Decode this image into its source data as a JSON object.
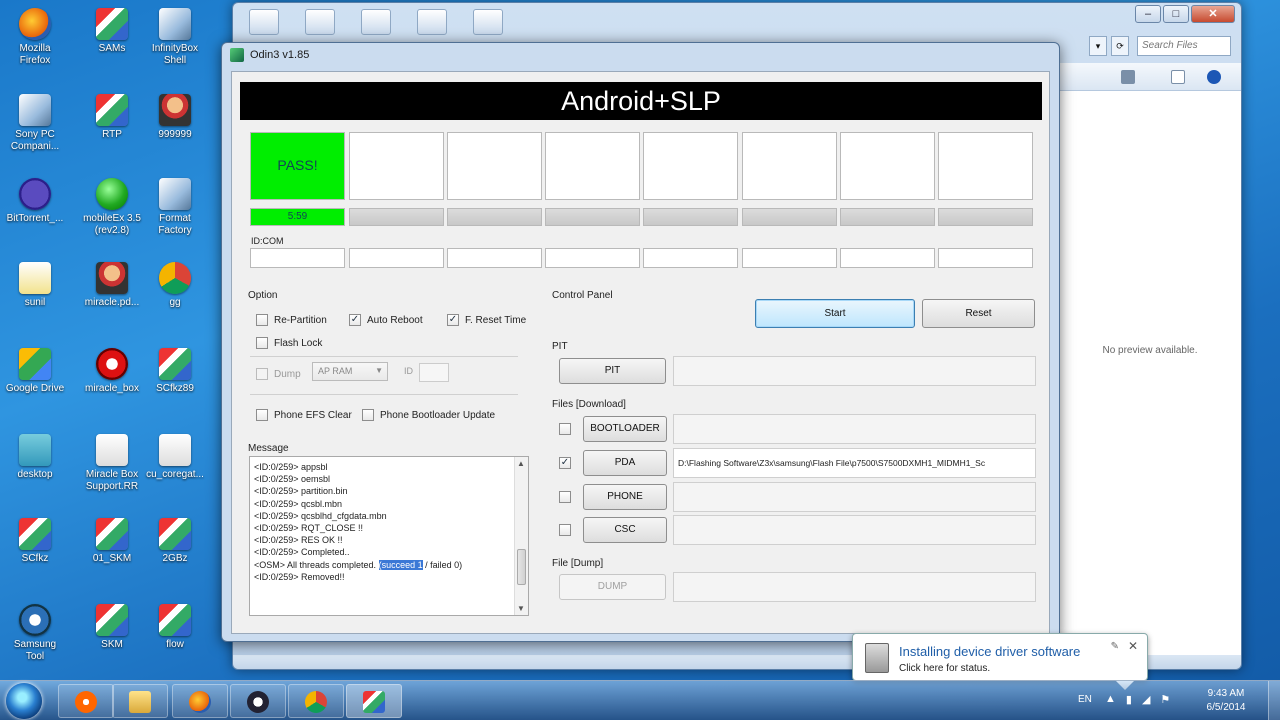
{
  "desktop": {
    "icons": [
      {
        "label": "Mozilla\nFirefox",
        "kind": "firefox",
        "name": "desktop-icon-firefox"
      },
      {
        "label": "SAMs",
        "kind": "app",
        "name": "desktop-icon-sams"
      },
      {
        "label": "InfinityBox\nShell",
        "kind": "win",
        "name": "desktop-icon-infinitybox"
      },
      {
        "label": "Sony PC\nCompani...",
        "kind": "win",
        "name": "desktop-icon-sony-pc"
      },
      {
        "label": "RTP",
        "kind": "app",
        "name": "desktop-icon-rtp"
      },
      {
        "label": "999999",
        "kind": "person",
        "name": "desktop-icon-999999"
      },
      {
        "label": "BitTorrent_...",
        "kind": "torrent",
        "name": "desktop-icon-bittorrent"
      },
      {
        "label": "mobileEx 3.5\n(rev2.8)",
        "kind": "globe",
        "name": "desktop-icon-mobileex"
      },
      {
        "label": "Format\nFactory",
        "kind": "win",
        "name": "desktop-icon-format-factory"
      },
      {
        "label": "sunil",
        "kind": "doc",
        "name": "desktop-icon-sunil"
      },
      {
        "label": "miracle.pd...",
        "kind": "person",
        "name": "desktop-icon-miracle-pd"
      },
      {
        "label": "gg",
        "kind": "chrome",
        "name": "desktop-icon-gg"
      },
      {
        "label": "Google Drive",
        "kind": "drive",
        "name": "desktop-icon-google-drive"
      },
      {
        "label": "miracle_box",
        "kind": "mirac",
        "name": "desktop-icon-miracle-box"
      },
      {
        "label": "SCfkz89",
        "kind": "app",
        "name": "desktop-icon-scfkz89"
      },
      {
        "label": "desktop",
        "kind": "desktop",
        "name": "desktop-icon-desktop"
      },
      {
        "label": "Miracle Box\nSupport.RR",
        "kind": "paper",
        "name": "desktop-icon-miracle-box-support"
      },
      {
        "label": "cu_coregat...",
        "kind": "paper",
        "name": "desktop-icon-cu-coregat"
      },
      {
        "label": "SCfkz",
        "kind": "app",
        "name": "desktop-icon-scfkz"
      },
      {
        "label": "01_SKM",
        "kind": "app",
        "name": "desktop-icon-01-skm"
      },
      {
        "label": "2GBz",
        "kind": "app",
        "name": "desktop-icon-2gbz"
      },
      {
        "label": "Samsung\nTool",
        "kind": "gear",
        "name": "desktop-icon-samsung-tool"
      },
      {
        "label": "SKM",
        "kind": "app",
        "name": "desktop-icon-skm"
      },
      {
        "label": "flow",
        "kind": "app",
        "name": "desktop-icon-flow"
      }
    ]
  },
  "explorer": {
    "search_placeholder": "Search Files",
    "preview_text": "No preview available."
  },
  "odin": {
    "title": "Odin3 v1.85",
    "banner": "Android+SLP",
    "port_status": "PASS!",
    "port_time": "5:59",
    "idcom_label": "ID:COM",
    "option": {
      "label": "Option",
      "re_partition": "Re-Partition",
      "auto_reboot": "Auto Reboot",
      "f_reset_time": "F. Reset Time",
      "flash_lock": "Flash Lock",
      "dump": "Dump",
      "ap_ram": "AP RAM",
      "id_label": "ID",
      "phone_efs_clear": "Phone EFS Clear",
      "phone_bootloader_update": "Phone Bootloader Update"
    },
    "message": {
      "label": "Message",
      "lines": [
        "<ID:0/259> appsbl",
        "<ID:0/259> oemsbl",
        "<ID:0/259> partition.bin",
        "<ID:0/259> qcsbl.mbn",
        "<ID:0/259> qcsblhd_cfgdata.mbn",
        "<ID:0/259> RQT_CLOSE !!",
        "<ID:0/259> RES OK !!",
        "<ID:0/259> Completed..",
        "<ID:0/259> Removed!!"
      ],
      "osm_prefix": "<OSM> All threads completed.",
      "osm_highlight": "(succeed 1",
      "osm_suffix": "/ failed 0)"
    },
    "control_panel": {
      "label": "Control Panel",
      "start": "Start",
      "reset": "Reset"
    },
    "pit": {
      "label": "PIT",
      "button": "PIT"
    },
    "files": {
      "label": "Files [Download]",
      "bootloader": "BOOTLOADER",
      "pda": "PDA",
      "pda_path": "D:\\Flashing Software\\Z3x\\samsung\\Flash File\\p7500\\S7500DXMH1_MIDMH1_Sc",
      "phone": "PHONE",
      "csc": "CSC"
    },
    "dump": {
      "label": "File [Dump]",
      "button": "DUMP"
    }
  },
  "notification": {
    "title": "Installing device driver software",
    "subtitle": "Click here for status."
  },
  "taskbar": {
    "language": "EN",
    "time": "9:43 AM",
    "date": "6/5/2014"
  }
}
